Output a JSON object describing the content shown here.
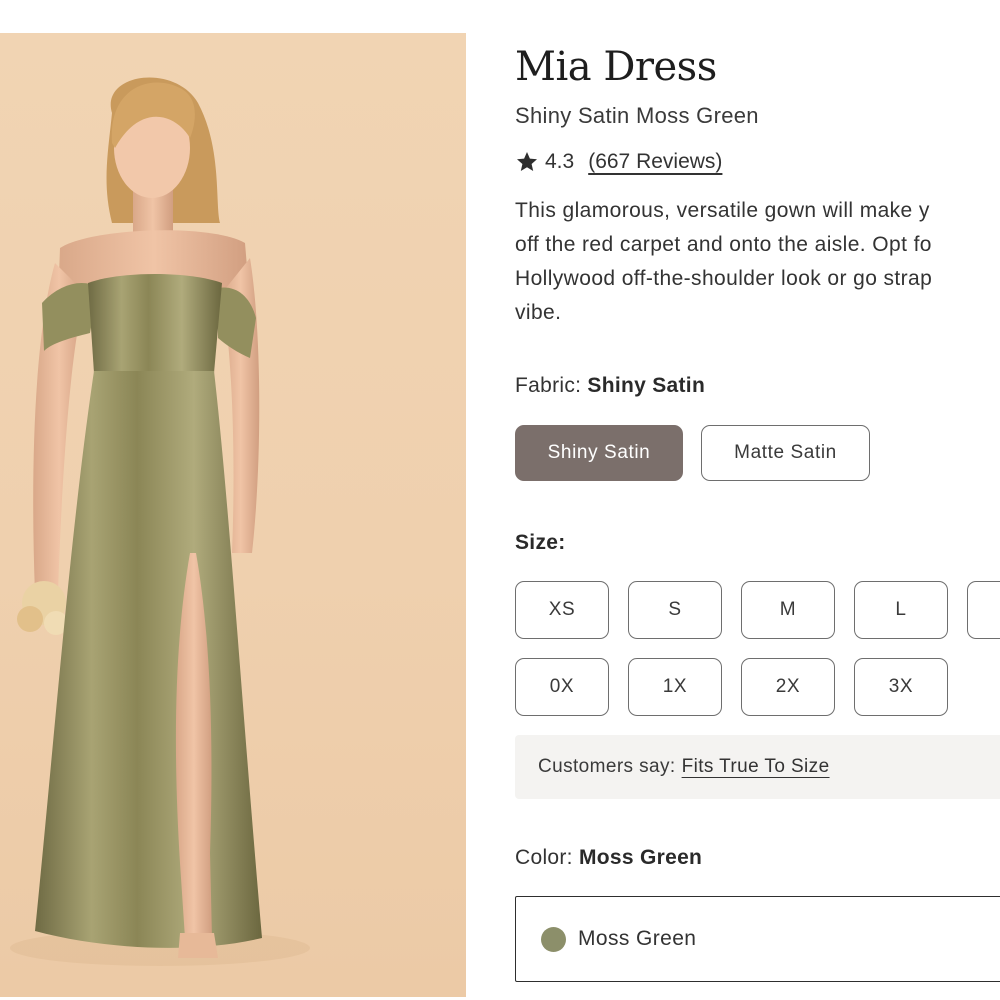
{
  "product": {
    "name": "Mia Dress",
    "subtitle": "Shiny Satin Moss Green",
    "rating": "4.3",
    "reviews_label": "(667 Reviews)",
    "description_lines": [
      "This glamorous, versatile gown will make y",
      "off the red carpet and onto the aisle. Opt fo",
      "Hollywood off-the-shoulder look or go strap",
      "vibe."
    ]
  },
  "fabric": {
    "label": "Fabric:",
    "selected": "Shiny Satin",
    "options": [
      {
        "label": "Shiny Satin",
        "selected": true
      },
      {
        "label": "Matte Satin",
        "selected": false
      }
    ]
  },
  "size": {
    "label": "Size:",
    "row1": [
      "XS",
      "S",
      "M",
      "L",
      ""
    ],
    "row2": [
      "0X",
      "1X",
      "2X",
      "3X"
    ]
  },
  "fit": {
    "prefix": "Customers say:",
    "link": "Fits True To Size"
  },
  "color": {
    "label": "Color:",
    "selected": "Moss Green",
    "swatch_hex": "#8c8f6a"
  },
  "icons": {
    "rating": "star-icon",
    "color_swatch": "color-swatch-circle"
  },
  "theme": {
    "selected_button_bg": "#7b6f6b",
    "photo_background": "#efd0ae",
    "dress_color": "#8f8a5e"
  }
}
